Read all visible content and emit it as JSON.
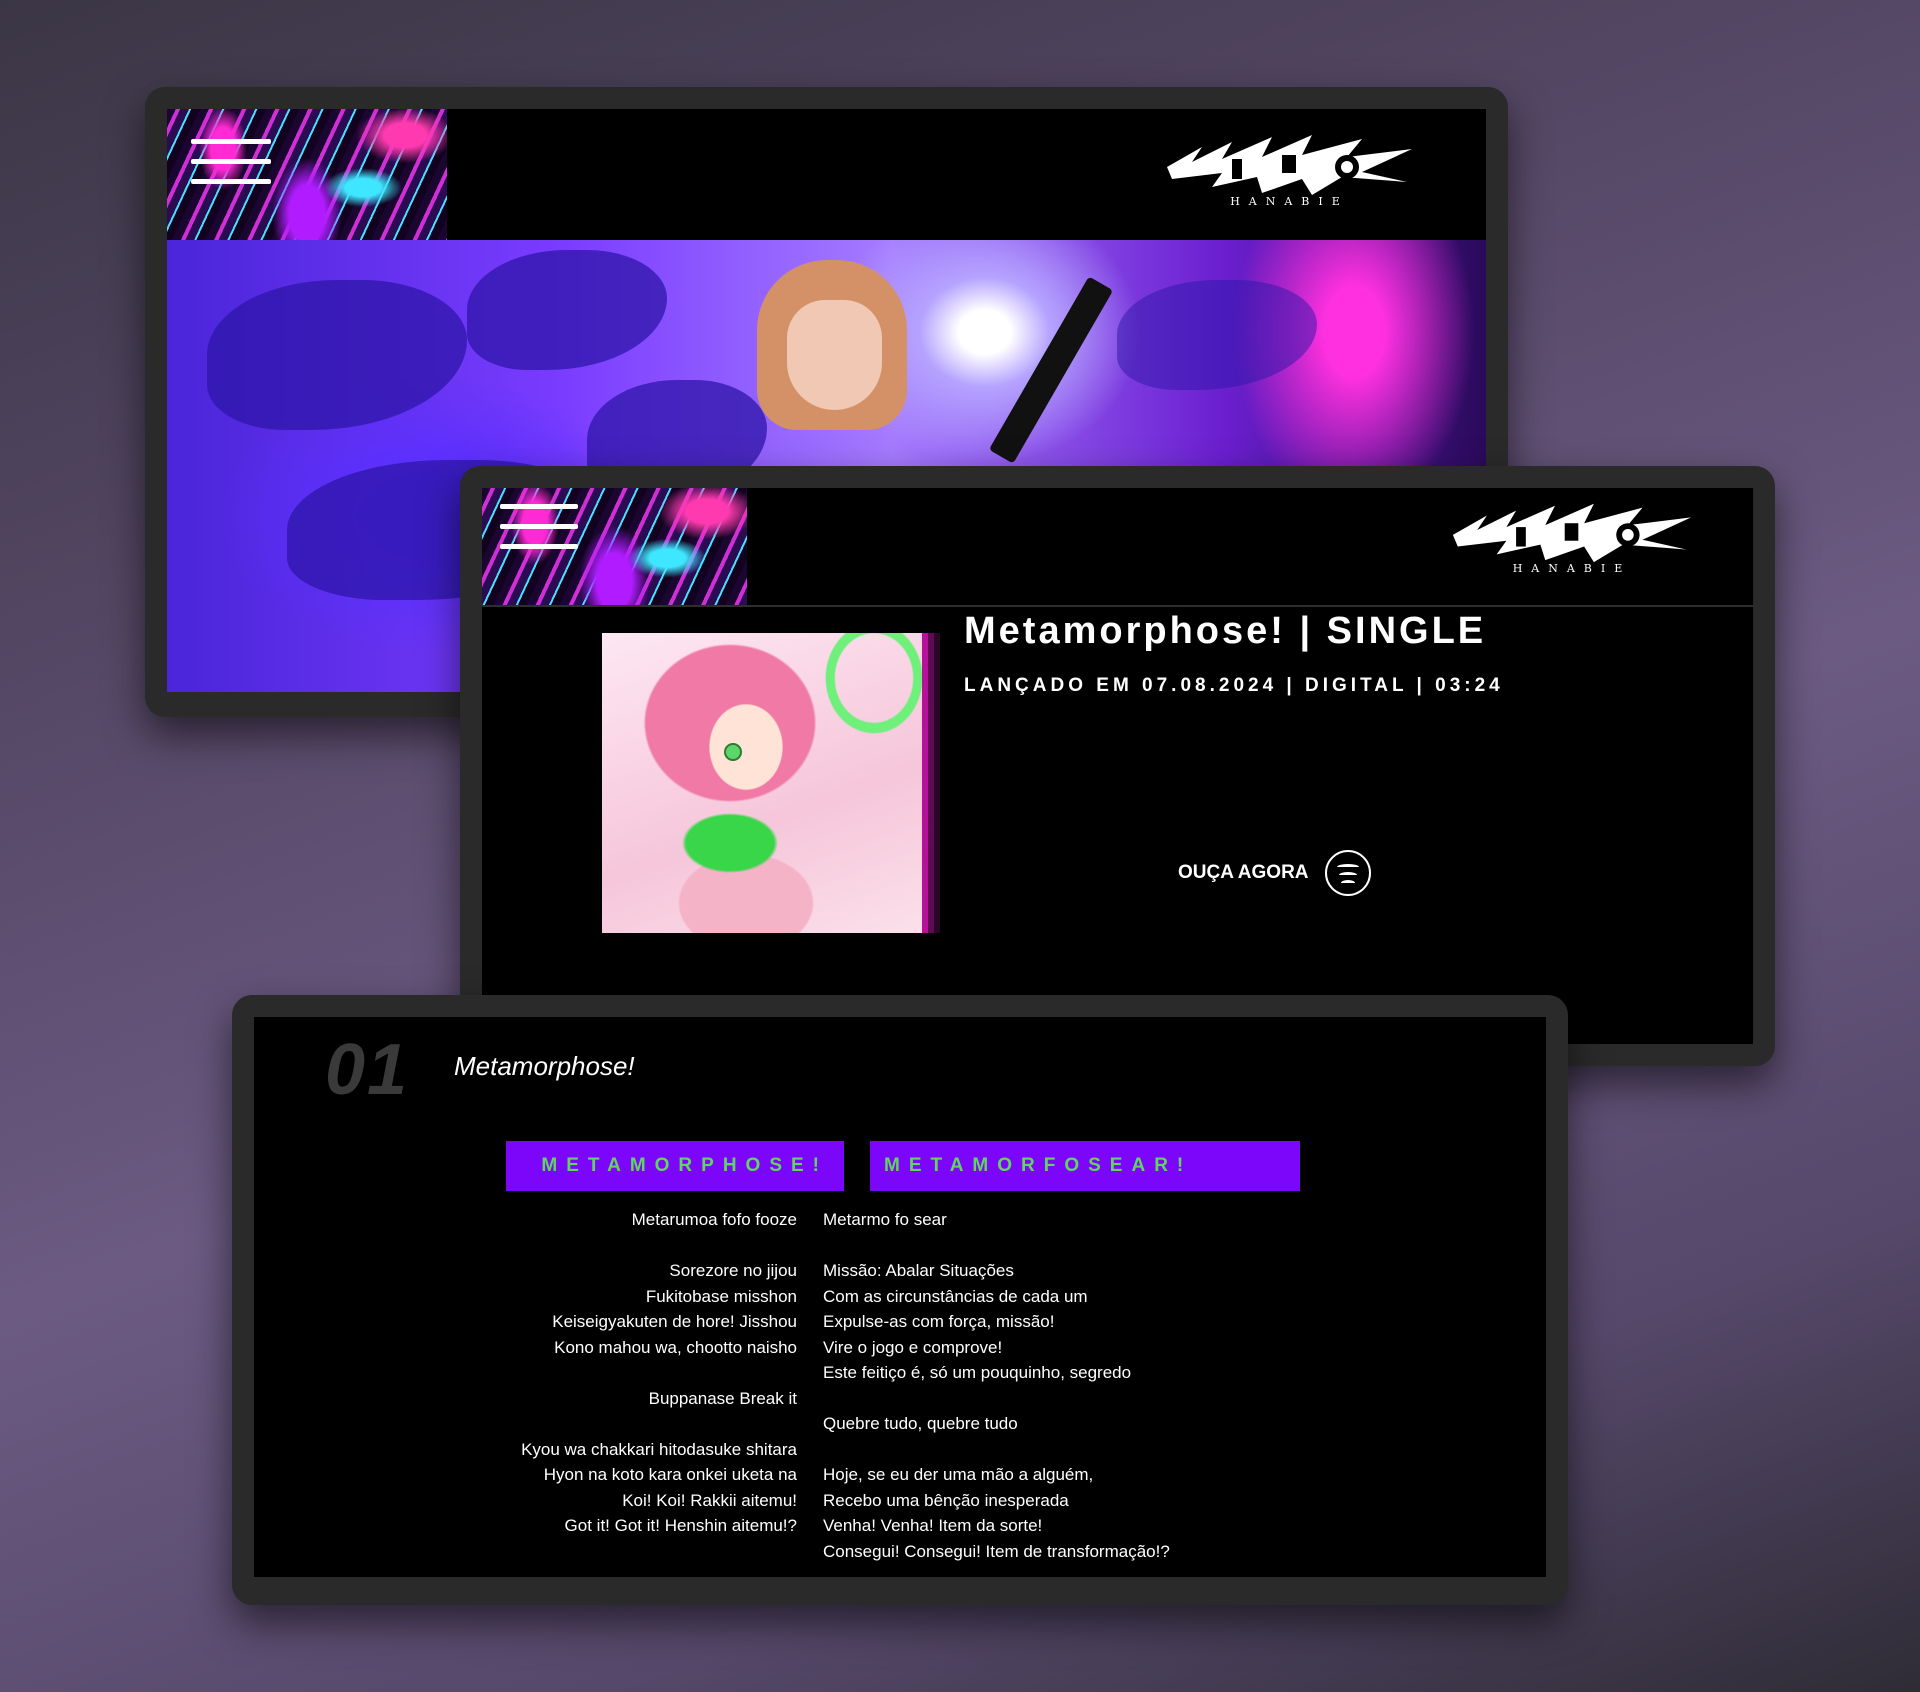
{
  "site": {
    "logo_sub": "HANABIE"
  },
  "release": {
    "title": "Metamorphose! | SINGLE",
    "meta": "LANÇADO EM 07.08.2024 | DIGITAL | 03:24",
    "listen_label": "OUÇA AGORA",
    "listen_icon": "spotify-icon"
  },
  "track": {
    "number": "01",
    "name": "Metamorphose!",
    "original_header": "METAMORPHOSE!",
    "translation_header": "METAMORFOSEAR!",
    "original_lines": [
      "Metarumoa fofo fooze",
      "",
      "Sorezore no jijou",
      "Fukitobase misshon",
      "Keiseigyakuten de hore! Jisshou",
      "Kono mahou wa, chootto naisho",
      "",
      "Buppanase Break it",
      "",
      "Kyou wa chakkari hitodasuke shitara",
      "Hyon na koto kara onkei uketa na",
      "Koi! Koi! Rakkii aitemu!",
      "Got it! Got it! Henshin aitemu!?"
    ],
    "translation_lines": [
      "Metarmo fo sear",
      "",
      "Missão: Abalar Situações",
      "Com as circunstâncias de cada um",
      "Expulse-as com força, missão!",
      "Vire o jogo e comprove!",
      "Este feitiço é, só um pouquinho, segredo",
      "",
      "Quebre tudo, quebre tudo",
      "",
      "Hoje, se eu der uma mão a alguém,",
      "Recebo uma bênção inesperada",
      "Venha! Venha! Item da sorte!",
      "Consegui! Consegui! Item de transformação!?"
    ]
  },
  "colors": {
    "accent_purple": "#7b06fa",
    "accent_green": "#5fd65d",
    "background": "#000000"
  }
}
